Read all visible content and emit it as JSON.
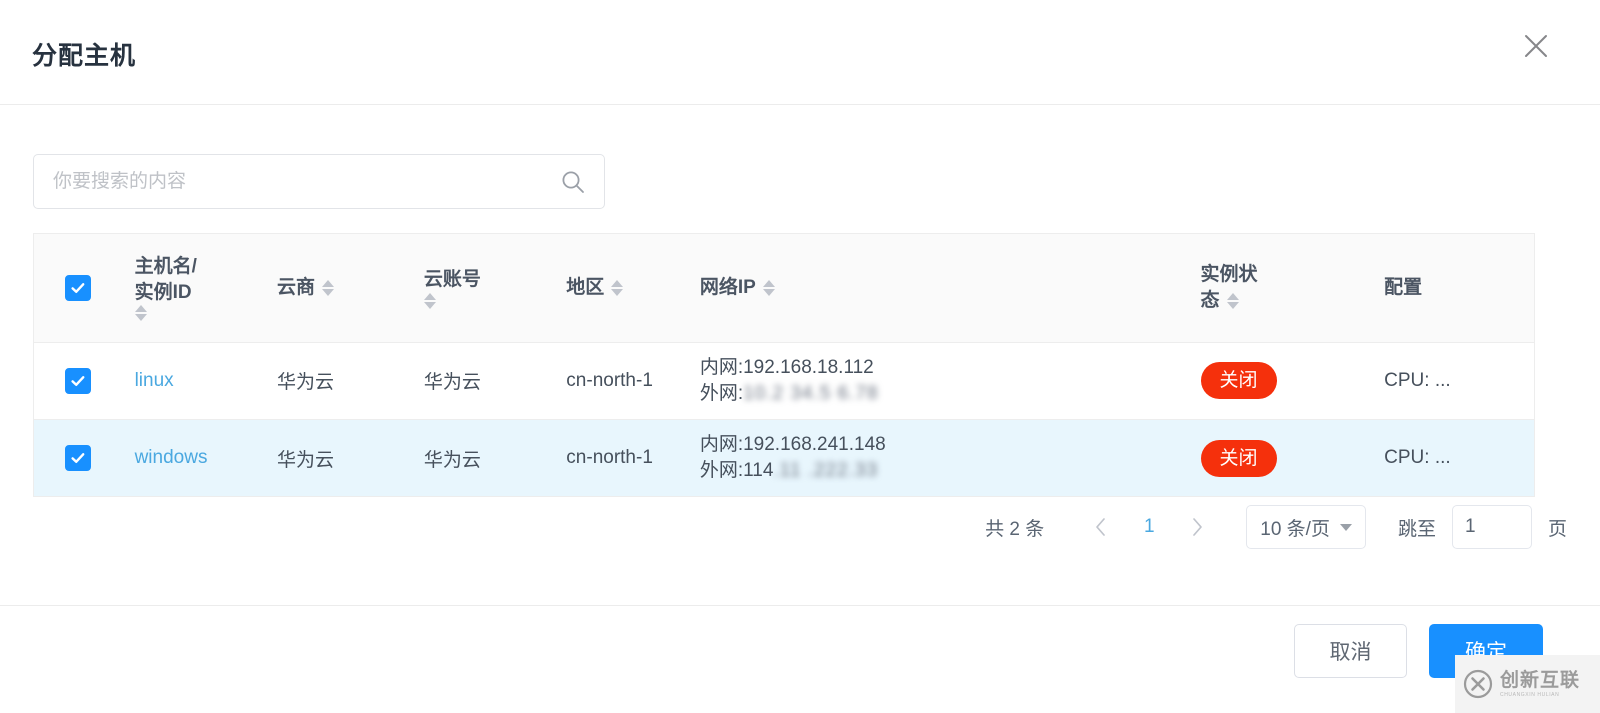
{
  "dialog": {
    "title": "分配主机",
    "close_icon": "close-icon"
  },
  "search": {
    "placeholder": "你要搜索的内容",
    "value": "",
    "icon": "search-icon"
  },
  "table": {
    "select_all_checked": true,
    "columns": [
      {
        "key": "select",
        "label": "",
        "sortable": false
      },
      {
        "key": "name",
        "label": "主机名/",
        "label2": "实例ID",
        "sortable": true
      },
      {
        "key": "vendor",
        "label": "云商",
        "sortable": true
      },
      {
        "key": "account",
        "label": "云账号",
        "sortable": true
      },
      {
        "key": "region",
        "label": "地区",
        "sortable": true
      },
      {
        "key": "ip",
        "label": "网络IP",
        "sortable": true
      },
      {
        "key": "state",
        "label": "实例状",
        "label2": "态",
        "sortable": true
      },
      {
        "key": "config",
        "label": "配置",
        "sortable": false
      }
    ],
    "rows": [
      {
        "checked": true,
        "selected": false,
        "name": "linux",
        "vendor": "华为云",
        "account": "华为云",
        "region": "cn-north-1",
        "ip_intranet": "内网:192.168.18.112",
        "ip_extranet_label": "外网:",
        "ip_extranet_value": "10.2  34.5 6.78",
        "state": "关闭",
        "config": "CPU: ..."
      },
      {
        "checked": true,
        "selected": true,
        "name": "windows",
        "vendor": "华为云",
        "account": "华为云",
        "region": "cn-north-1",
        "ip_intranet": "内网:192.168.241.148",
        "ip_extranet_label": "外网:114",
        "ip_extranet_value": ".11 .222.33",
        "state": "关闭",
        "config": "CPU: ..."
      }
    ]
  },
  "pagination": {
    "total_text": "共 2 条",
    "prev_icon": "chevron-left-icon",
    "next_icon": "chevron-right-icon",
    "current_page": "1",
    "page_size_label": "10 条/页",
    "jump_label": "跳至",
    "jump_value": "1",
    "jump_unit": "页"
  },
  "footer": {
    "cancel_label": "取消",
    "confirm_label": "确定"
  },
  "watermark": {
    "main": "创新互联",
    "sub": "CHUANGXIN HULIAN"
  },
  "colors": {
    "primary": "#1890ff",
    "link": "#4aa8e0",
    "danger": "#f5300c",
    "row_selected": "#e8f6fd",
    "header_bg": "#fafafa"
  }
}
